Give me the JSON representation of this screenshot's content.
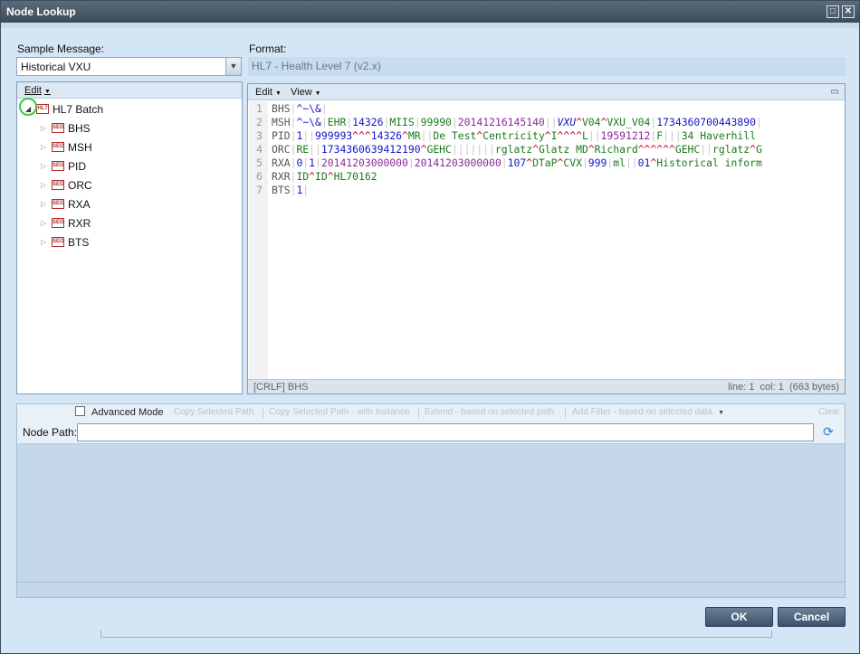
{
  "window": {
    "title": "Node Lookup"
  },
  "sample": {
    "label": "Sample Message:",
    "value": "Historical VXU"
  },
  "format": {
    "label": "Format:",
    "value": "HL7 - Health Level 7 (v2.x)"
  },
  "tree": {
    "menu_edit": "Edit",
    "root": {
      "label": "HL7 Batch",
      "icon": "hl7-node-icon"
    },
    "items": [
      "BHS",
      "MSH",
      "PID",
      "ORC",
      "RXA",
      "RXR",
      "BTS"
    ]
  },
  "editor": {
    "menu_edit": "Edit",
    "menu_view": "View",
    "line_numbers": [
      "1",
      "2",
      "3",
      "4",
      "5",
      "6",
      "7"
    ],
    "status_left": "[CRLF] BHS",
    "status_right": "line: 1  col: 1  (663 bytes)"
  },
  "lower": {
    "advanced_label": "Advanced Mode",
    "copy_path": "Copy Selected Path",
    "copy_path_instance": "Copy Selected Path - with Instance",
    "extend": "Extend - based on selected path",
    "add_filter": "Add Filter - based on selected data",
    "clear": "Clear",
    "node_path_label": "Node Path:",
    "node_path_value": ""
  },
  "buttons": {
    "ok": "OK",
    "cancel": "Cancel"
  },
  "colors": {
    "field_sep": "#c8c8c8",
    "literal": "#1515c8",
    "code_green": "#1b7a1b",
    "comp_red": "#cc0033",
    "purple": "#8a2a9a"
  }
}
